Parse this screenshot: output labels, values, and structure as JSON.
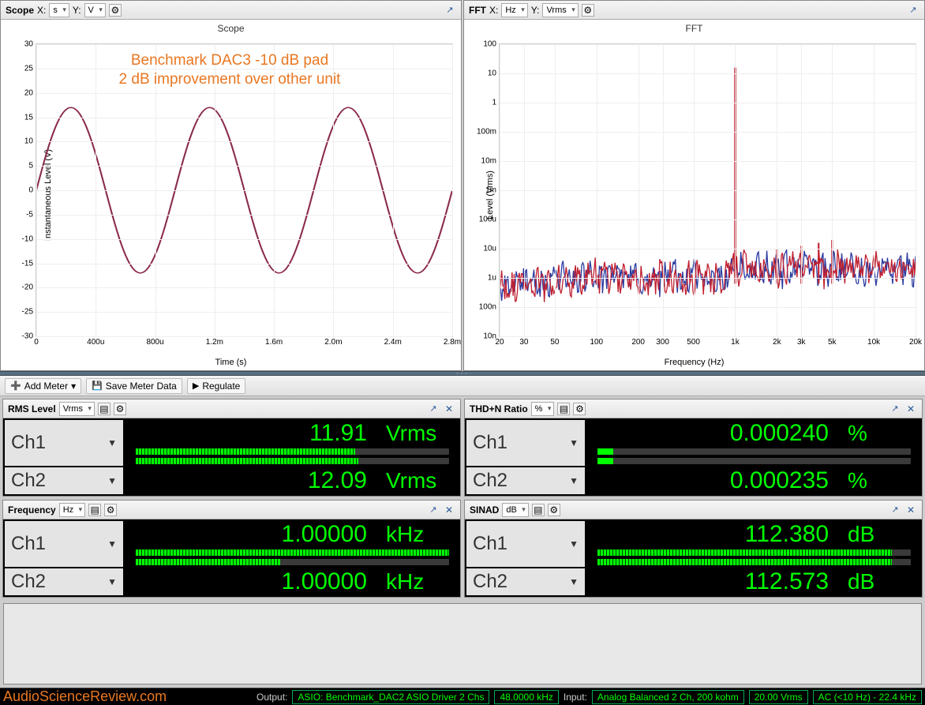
{
  "scope": {
    "title": "Scope",
    "x_label": "X:",
    "x_value": "s",
    "y_label": "Y:",
    "y_value": "V",
    "chart_title": "Scope",
    "annotation_line1": "Benchmark DAC3 -10 dB pad",
    "annotation_line2": "2 dB improvement over other unit",
    "ylabel": "Instantaneous Level (V)",
    "xlabel": "Time (s)",
    "yticks": [
      "30",
      "25",
      "20",
      "15",
      "10",
      "5",
      "0",
      "-5",
      "-10",
      "-15",
      "-20",
      "-25",
      "-30"
    ],
    "xticks": [
      "0",
      "400u",
      "800u",
      "1.2m",
      "1.6m",
      "2.0m",
      "2.4m",
      "2.8m"
    ]
  },
  "fft": {
    "title": "FFT",
    "x_label": "X:",
    "x_value": "Hz",
    "y_label": "Y:",
    "y_value": "Vrms",
    "chart_title": "FFT",
    "ylabel": "Level (Vrms)",
    "xlabel": "Frequency (Hz)",
    "yticks": [
      "100",
      "10",
      "1",
      "100m",
      "10m",
      "1m",
      "100u",
      "10u",
      "1u",
      "100n",
      "10n"
    ],
    "xticks": [
      "20",
      "30",
      "50",
      "100",
      "200",
      "300",
      "500",
      "1k",
      "2k",
      "3k",
      "5k",
      "10k",
      "20k"
    ]
  },
  "toolbar": {
    "add_meter": "Add Meter",
    "save_meter": "Save Meter Data",
    "regulate": "Regulate"
  },
  "meters": {
    "rms": {
      "title": "RMS Level",
      "unit_select": "Vrms",
      "ch1_label": "Ch1",
      "ch1_value": "11.91",
      "ch1_unit": "Vrms",
      "ch2_label": "Ch2",
      "ch2_value": "12.09",
      "ch2_unit": "Vrms",
      "ch1_bar_pct": 70,
      "ch2_bar_pct": 71
    },
    "thdn": {
      "title": "THD+N Ratio",
      "unit_select": "%",
      "ch1_label": "Ch1",
      "ch1_value": "0.000240",
      "ch1_unit": "%",
      "ch2_label": "Ch2",
      "ch2_value": "0.000235",
      "ch2_unit": "%",
      "ch1_bar_pct": 5,
      "ch2_bar_pct": 5
    },
    "freq": {
      "title": "Frequency",
      "unit_select": "Hz",
      "ch1_label": "Ch1",
      "ch1_value": "1.00000",
      "ch1_unit": "kHz",
      "ch2_label": "Ch2",
      "ch2_value": "1.00000",
      "ch2_unit": "kHz",
      "ch1_bar_pct": 100,
      "ch2_bar_pct": 46
    },
    "sinad": {
      "title": "SINAD",
      "unit_select": "dB",
      "ch1_label": "Ch1",
      "ch1_value": "112.380",
      "ch1_unit": "dB",
      "ch2_label": "Ch2",
      "ch2_value": "112.573",
      "ch2_unit": "dB",
      "ch1_bar_pct": 94,
      "ch2_bar_pct": 94
    }
  },
  "status": {
    "watermark": "AudioScienceReview.com",
    "output_lbl": "Output:",
    "output_driver": "ASIO: Benchmark_DAC2 ASIO Driver 2 Chs",
    "sample_rate": "48.0000 kHz",
    "input_lbl": "Input:",
    "input_config": "Analog Balanced 2 Ch, 200 kohm",
    "voltage": "20.00 Vrms",
    "bandwidth": "AC (<10 Hz) - 22.4 kHz"
  },
  "chart_data": [
    {
      "type": "line",
      "title": "Scope",
      "xlabel": "Time (s)",
      "ylabel": "Instantaneous Level (V)",
      "xlim": [
        0,
        0.003
      ],
      "ylim": [
        -30,
        30
      ],
      "series": [
        {
          "name": "Ch1",
          "color": "#8a2a4a",
          "amplitude": 17,
          "frequency_hz": 1000,
          "phase": 0
        },
        {
          "name": "Ch2",
          "color": "#3a4a9a",
          "amplitude": 17,
          "frequency_hz": 1000,
          "phase": 0
        }
      ],
      "note": "3 full cycles of ~17 V peak 1 kHz sine; channels overlap"
    },
    {
      "type": "line",
      "title": "FFT",
      "xlabel": "Frequency (Hz)",
      "ylabel": "Level (Vrms)",
      "x_scale": "log",
      "y_scale": "log",
      "xlim": [
        20,
        20000
      ],
      "ylim": [
        1e-08,
        100
      ],
      "series": [
        {
          "name": "Ch1",
          "color": "#c02030",
          "noise_floor_approx": 3e-07,
          "peaks": [
            {
              "freq_hz": 1000,
              "level_vrms": 12
            },
            {
              "freq_hz": 2000,
              "level_vrms": 7e-06
            },
            {
              "freq_hz": 3000,
              "level_vrms": 6e-06
            },
            {
              "freq_hz": 4000,
              "level_vrms": 3e-06
            },
            {
              "freq_hz": 5000,
              "level_vrms": 5e-06
            }
          ]
        },
        {
          "name": "Ch2",
          "color": "#2a3aa0",
          "noise_floor_approx": 3e-07,
          "peaks": [
            {
              "freq_hz": 1000,
              "level_vrms": 12
            },
            {
              "freq_hz": 2000,
              "level_vrms": 6e-06
            },
            {
              "freq_hz": 3000,
              "level_vrms": 5e-06
            }
          ]
        }
      ]
    }
  ]
}
